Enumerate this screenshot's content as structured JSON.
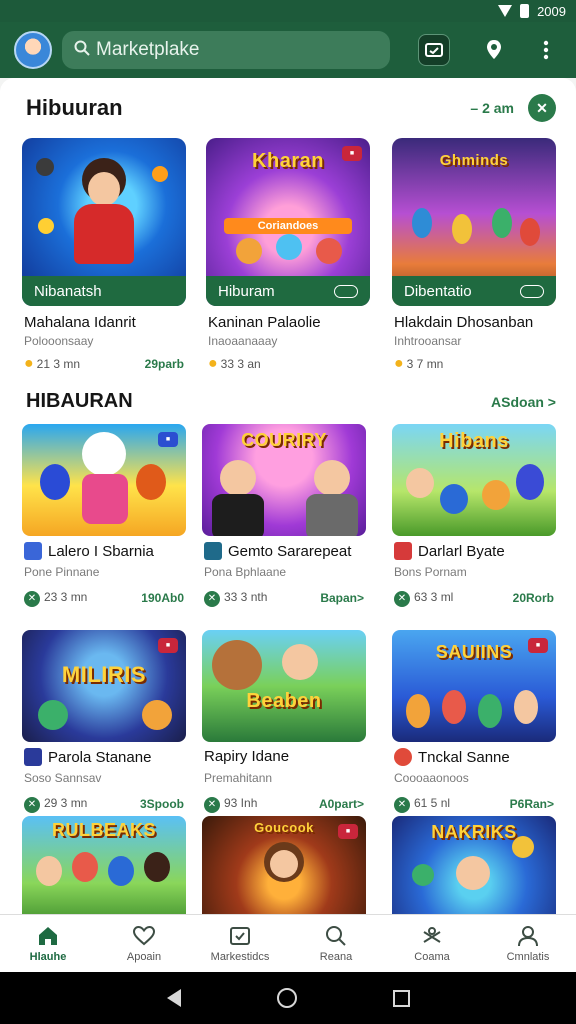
{
  "status": {
    "time": "2009"
  },
  "search": {
    "placeholder": "Marketplake"
  },
  "section1": {
    "title": "Hibuuran",
    "link": "– 2 am",
    "cards": [
      {
        "banner": "Nibanatsh",
        "name": "Mahalana Idanrit",
        "sub": "Polooonsaay",
        "rating": "21 3 mn",
        "price": "29parb"
      },
      {
        "banner": "Hiburam",
        "logo": "Kharan",
        "logo_sub": "Coriandoes",
        "name": "Kaninan Palaolie",
        "sub": "Inaoaanaaay",
        "rating": "33 3 an",
        "price": ""
      },
      {
        "banner": "Dibentatio",
        "logo": "Ghminds",
        "name": "Hlakdain Dhosanban",
        "sub": "Inhtrooansar",
        "rating": "3 7 mn",
        "price": ""
      }
    ]
  },
  "section2": {
    "title": "HIBAURAN",
    "link": "ASdoan >",
    "tiles": [
      {
        "name": "Lalero I Sbarnia",
        "sub": "Pone Pinnane",
        "rating": "23 3 mn",
        "price": "190Ab0",
        "logo": ""
      },
      {
        "name": "Gemto Sararepeat",
        "sub": "Pona Bphlaane",
        "rating": "33 3 nth",
        "price": "Bapan>",
        "logo": "COURIRY"
      },
      {
        "name": "Darlarl Byate",
        "sub": "Bons Pornam",
        "rating": "63 3 ml",
        "price": "20Rorb",
        "logo": "Hibans"
      },
      {
        "name": "Parola Stanane",
        "sub": "Soso Sannsav",
        "rating": "29 3 mn",
        "price": "3Spoob",
        "logo": "MILIRIS"
      },
      {
        "name": "Rapiry Idane",
        "sub": "Premahitann",
        "rating": "93 Inh",
        "price": "A0part>",
        "logo": "Beaben"
      },
      {
        "name": "Tnckal Sanne",
        "sub": "Coooaaonoos",
        "rating": "61 5 nl",
        "price": "P6Ran>",
        "logo": "SAUIINS"
      },
      {
        "name": "",
        "sub": "",
        "rating": "",
        "price": "",
        "logo": "RULBEAKS"
      },
      {
        "name": "",
        "sub": "",
        "rating": "",
        "price": "",
        "logo": "Goucook"
      },
      {
        "name": "",
        "sub": "",
        "rating": "",
        "price": "",
        "logo": "NAKRIKS"
      }
    ]
  },
  "bottom_nav": [
    {
      "label": "Hlauhe",
      "icon": "home-icon"
    },
    {
      "label": "Apoain",
      "icon": "heart-icon"
    },
    {
      "label": "Markestidcs",
      "icon": "wallet-icon"
    },
    {
      "label": "Reana",
      "icon": "search-icon"
    },
    {
      "label": "Coama",
      "icon": "gamepad-icon"
    },
    {
      "label": "Cmnlatis",
      "icon": "profile-icon"
    }
  ],
  "colors": {
    "brand": "#1e5e3c",
    "accent": "#2a7a4a"
  }
}
